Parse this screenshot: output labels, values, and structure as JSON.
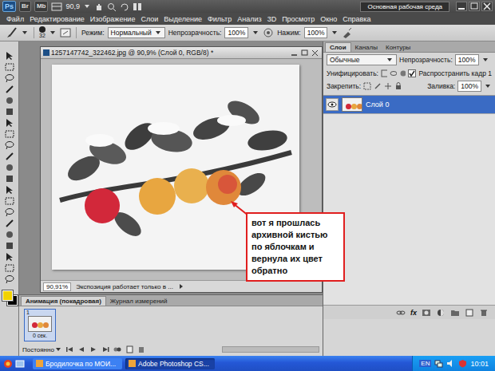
{
  "app": {
    "logo": "Ps",
    "bridge": "Br",
    "mini_bridge": "Mb",
    "zoom": "90,9",
    "workspace": "Основная рабочая среда"
  },
  "menu": [
    "Файл",
    "Редактирование",
    "Изображение",
    "Слои",
    "Выделение",
    "Фильтр",
    "Анализ",
    "3D",
    "Просмотр",
    "Окно",
    "Справка"
  ],
  "options_bar": {
    "brush_size": "32",
    "mode_label": "Режим:",
    "mode": "Нормальный",
    "opacity_label": "Непрозрачность:",
    "opacity": "100%",
    "flow_label": "Нажим:",
    "flow": "100%"
  },
  "document": {
    "title": "1257147742_322462.jpg @ 90,9% (Слой 0, RGB/8) *",
    "zoom": "90,91%",
    "status": "Экспозиция работает только в ..."
  },
  "callout": "вот я прошлась архивной кистью по яблочкам и вернула их цвет обратно",
  "swatches": [
    {
      "name": "foreground",
      "color": "#f2d200"
    },
    {
      "name": "background",
      "color": "#000000"
    }
  ],
  "layers_panel": {
    "tabs": [
      {
        "label": "Слои",
        "selected": true
      },
      {
        "label": "Каналы",
        "selected": false
      },
      {
        "label": "Контуры",
        "selected": false
      }
    ],
    "blend_mode": "Обычные",
    "opacity_label": "Непрозрачность:",
    "opacity": "100%",
    "unify_label": "Унифицировать:",
    "propagate_label": "Распространить кадр 1",
    "propagate_checked": true,
    "lock_label": "Закрепить:",
    "fill_label": "Заливка:",
    "fill": "100%",
    "layers": [
      {
        "name": "Слой 0",
        "selected": true,
        "visible": true
      }
    ],
    "fx_label": "fx"
  },
  "animation_panel": {
    "tabs": [
      {
        "label": "Анимация (покадровая)",
        "selected": true
      },
      {
        "label": "Журнал измерений",
        "selected": false
      }
    ],
    "frames": [
      {
        "number": "1",
        "delay": "0 сек.",
        "selected": true
      }
    ],
    "loop": "Постоянно"
  },
  "taskbar": {
    "items": [
      {
        "label": "Бродилочка по МОИ...",
        "selected": false
      },
      {
        "label": "Adobe Photoshop CS...",
        "selected": true
      }
    ],
    "language": "EN",
    "time": "10:01"
  }
}
